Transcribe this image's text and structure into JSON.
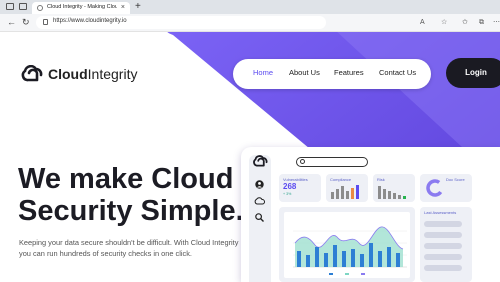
{
  "browser": {
    "tab_title": "Cloud Integrity - Making Cloud S",
    "tab_close": "×",
    "new_tab": "+",
    "back": "←",
    "refresh": "↻",
    "url": "https://www.cloudintegrity.io",
    "read_aloud": "A",
    "favorite": "☆",
    "favorites_bar": "✩",
    "collections": "⧉",
    "more": "⋯"
  },
  "site": {
    "logo": {
      "bold": "Cloud",
      "regular": "Integrity"
    },
    "nav": [
      {
        "label": "Home",
        "active": true
      },
      {
        "label": "About Us",
        "active": false
      },
      {
        "label": "Features",
        "active": false
      },
      {
        "label": "Contact Us",
        "active": false
      }
    ],
    "login_label": "Login",
    "headline_line1": "We make Cloud",
    "headline_line2": "Security Simple.",
    "subtext": "Keeping your data secure shouldn't be difficult. With Cloud Integrity you can run hundreds of security checks in one click."
  },
  "dashboard": {
    "cards": {
      "vulnerabilities": {
        "label": "Vulnerabilities",
        "value": "268",
        "change": "+ 3%"
      },
      "compliance": {
        "label": "Compliance"
      },
      "risk": {
        "label": "Risk"
      },
      "doc_score": {
        "label": "Doc Score"
      },
      "last_assessments": {
        "label": "Last Assessments"
      }
    }
  },
  "colors": {
    "accent": "#5b4bf0",
    "hero_gradient_start": "#7b63f5",
    "hero_gradient_end": "#5a3fd8",
    "chart_blue": "#2d7fd4",
    "chart_teal": "#7ed6c4",
    "chart_line": "#8a7bf0"
  },
  "icons": {
    "sidebar": [
      "user-icon",
      "cloud-icon",
      "search-icon"
    ]
  }
}
